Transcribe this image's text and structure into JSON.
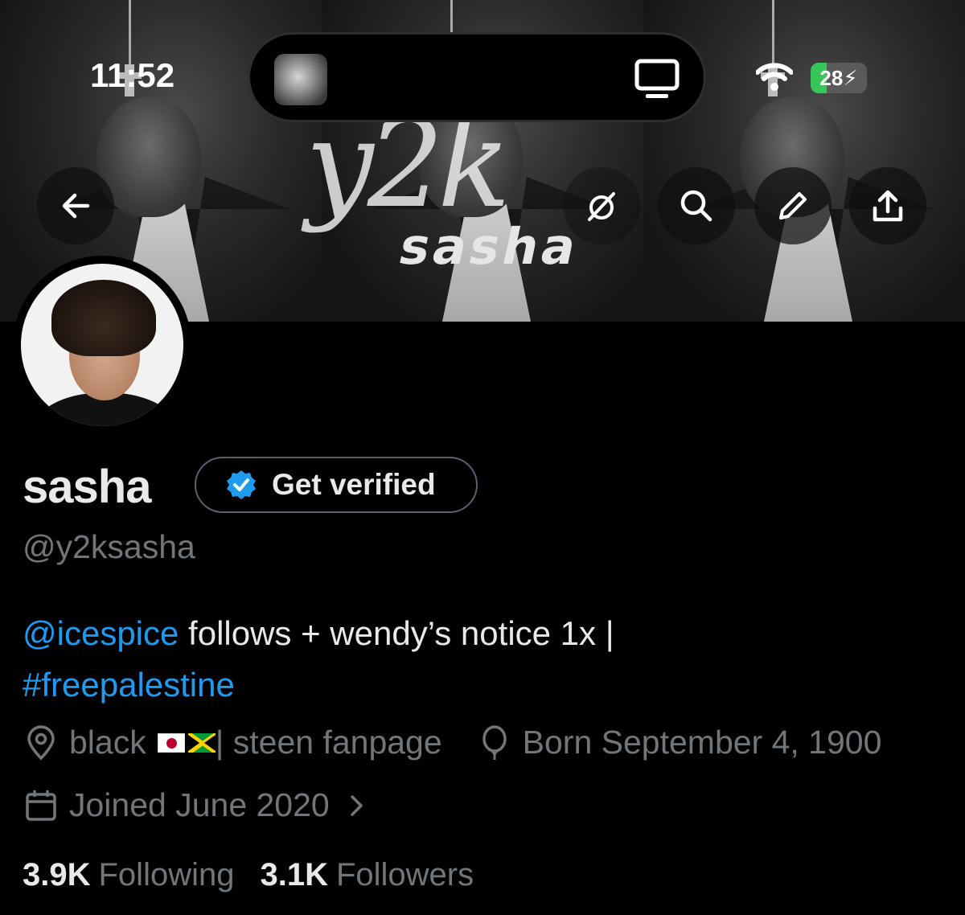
{
  "status_bar": {
    "time": "11:52",
    "battery_level": "28",
    "battery_charging": true,
    "battery_fill_fraction": 0.28,
    "icons": [
      "tv-icon",
      "wifi-icon",
      "battery-icon"
    ]
  },
  "banner": {
    "script_text": "y2k",
    "word_text": "sasha"
  },
  "toolbar": {
    "icons": [
      "back-arrow-icon",
      "grok-icon",
      "search-icon",
      "edit-pencil-icon",
      "share-icon"
    ]
  },
  "profile": {
    "display_name": "sasha",
    "verify_button_label": "Get verified",
    "handle": "@y2ksasha",
    "bio": {
      "mention": "@icespice",
      "text": " follows + wendy’s notice 1x |",
      "hashtag": "#freepalestine"
    },
    "location_prefix": "black",
    "location_suffix": " | steen fanpage",
    "birthday": "Born September 4, 1900",
    "joined": "Joined June 2020",
    "following_count": "3.9K",
    "following_label": "Following",
    "followers_count": "3.1K",
    "followers_label": "Followers"
  },
  "colors": {
    "background": "#000000",
    "text_primary": "#e7e9ea",
    "text_secondary": "#71767b",
    "link": "#1d9bf0",
    "verified_badge": "#1d9bf0",
    "battery": "#35c759"
  }
}
